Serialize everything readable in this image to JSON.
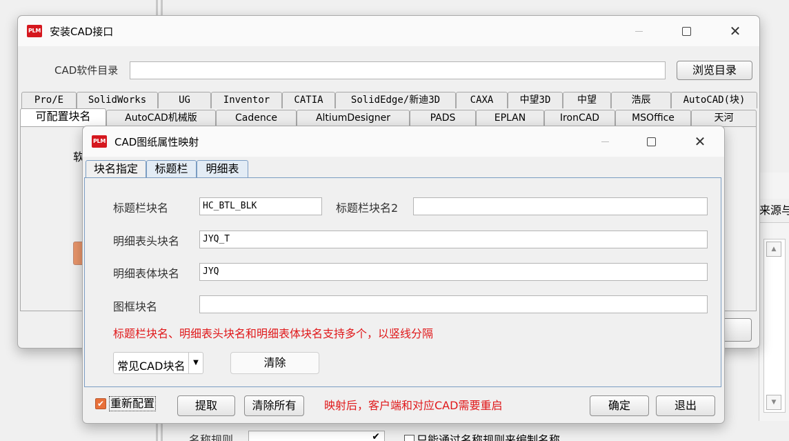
{
  "background": {
    "right_partial_label": "来源与",
    "bottom_label": "名称规则",
    "bottom_checkbox_label": "只能通过名称规则来编制名称"
  },
  "install_window": {
    "title": "安装CAD接口",
    "logo_text": "PLM",
    "dir_label": "CAD软件目录",
    "dir_value": "",
    "browse_label": "浏览目录",
    "tabs_row1": [
      "Pro/E",
      "SolidWorks",
      "UG",
      "Inventor",
      "CATIA",
      "SolidEdge/新迪3D",
      "CAXA",
      "中望3D",
      "中望",
      "浩辰",
      "AutoCAD(块)"
    ],
    "tabs_row2": [
      "可配置块名",
      "AutoCAD机械版",
      "Cadence",
      "AltiumDesigner",
      "PADS",
      "EPLAN",
      "IronCAD",
      "MSOffice",
      "天河"
    ],
    "selected_tab_row2": "可配置块名",
    "partial_text": "软"
  },
  "mapping_dialog": {
    "title": "CAD图纸属性映射",
    "logo_text": "PLM",
    "tabs": [
      "块名指定",
      "标题栏",
      "明细表"
    ],
    "selected_tab": "块名指定",
    "fields": {
      "title_block_label": "标题栏块名",
      "title_block_value": "HC_BTL_BLK",
      "title_block2_label": "标题栏块名2",
      "title_block2_value": "",
      "detail_header_label": "明细表头块名",
      "detail_header_value": "JYQ_T",
      "detail_body_label": "明细表体块名",
      "detail_body_value": "JYQ",
      "frame_block_label": "图框块名",
      "frame_block_value": ""
    },
    "hint": "标题栏块名、明细表头块名和明细表体块名支持多个，以竖线分隔",
    "common_names_label": "常见CAD块名",
    "clear_label": "清除",
    "reconfig_label": "重新配置",
    "reconfig_checked": true,
    "extract_label": "提取",
    "clear_all_label": "清除所有",
    "restart_note": "映射后，客户端和对应CAD需要重启",
    "ok_label": "确定",
    "exit_label": "退出"
  },
  "colors": {
    "accent_red": "#e0181a",
    "logo_red": "#d5171e",
    "checkbox_orange": "#e8703a"
  }
}
